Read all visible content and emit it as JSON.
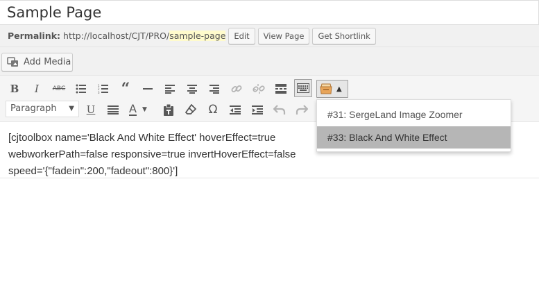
{
  "post": {
    "title": "Sample Page"
  },
  "permalink": {
    "label": "Permalink:",
    "base": "http://localhost/CJT/PRO/",
    "slug": "sample-page",
    "edit_label": "Edit",
    "view_label": "View Page",
    "shortlink_label": "Get Shortlink"
  },
  "media": {
    "add_media_label": "Add Media"
  },
  "toolbar": {
    "row1_icons": [
      "bold-icon",
      "italic-icon",
      "strikethrough-icon",
      "bullet-list-icon",
      "numbered-list-icon",
      "blockquote-icon",
      "horizontal-rule-icon",
      "align-left-icon",
      "align-center-icon",
      "align-right-icon",
      "link-icon",
      "unlink-icon",
      "read-more-icon",
      "toolbar-toggle-icon",
      "cjtoolbox-icon",
      "dropdown-arrow-icon"
    ],
    "format_select": "Paragraph",
    "row2_icons": [
      "underline-icon",
      "justify-icon",
      "text-color-icon",
      "paste-text-icon",
      "clear-formatting-icon",
      "special-character-icon",
      "outdent-icon",
      "indent-icon",
      "undo-icon",
      "redo-icon"
    ]
  },
  "content": {
    "lines": [
      "[cjtoolbox name='Black And White Effect' hoverEffect=true",
      "webworkerPath=false responsive=true invertHoverEffect=false",
      "speed='{\"fadein\":200,\"fadeout\":800}']"
    ]
  },
  "dropdown": {
    "items": [
      {
        "label": "#31: SergeLand Image Zoomer",
        "selected": false
      },
      {
        "label": "#33: Black And White Effect",
        "selected": true
      }
    ]
  }
}
